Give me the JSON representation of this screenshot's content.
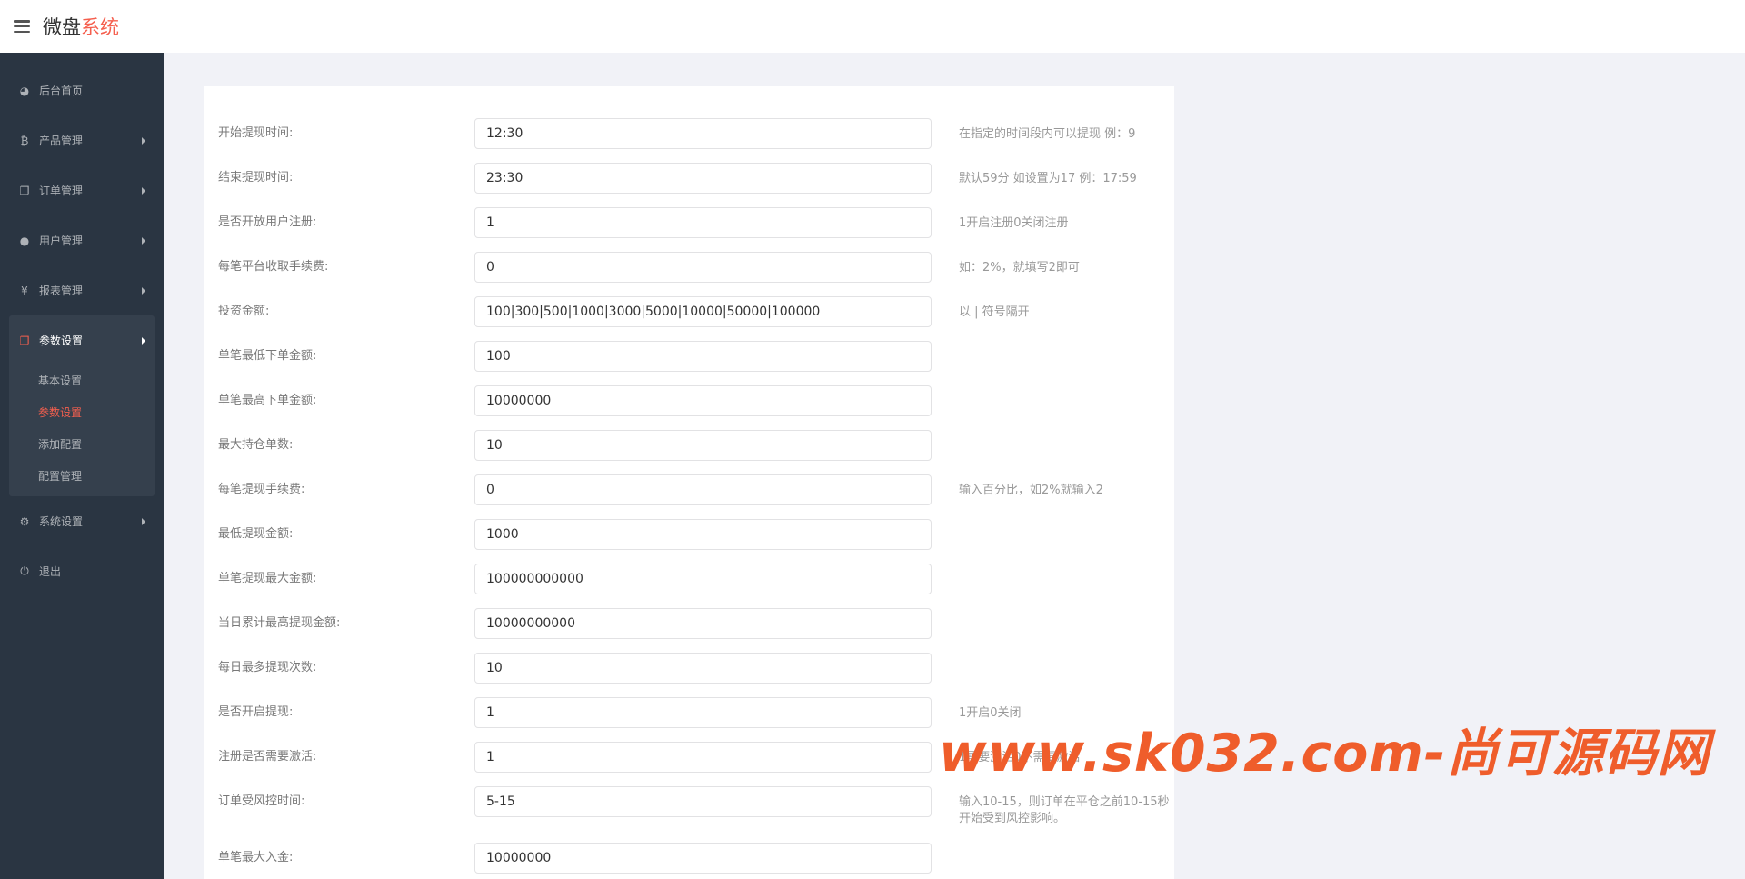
{
  "header": {
    "brand_main": "微盘",
    "brand_accent": "系统"
  },
  "sidebar": {
    "items": [
      {
        "label": "后台首页",
        "icon": "dashboard-icon",
        "glyph": "◕"
      },
      {
        "label": "产品管理",
        "icon": "bitcoin-icon",
        "glyph": "₿"
      },
      {
        "label": "订单管理",
        "icon": "copy-icon",
        "glyph": "❐"
      },
      {
        "label": "用户管理",
        "icon": "user-icon",
        "glyph": "●"
      },
      {
        "label": "报表管理",
        "icon": "yen-icon",
        "glyph": "¥"
      },
      {
        "label": "参数设置",
        "icon": "copy-icon",
        "glyph": "❐"
      },
      {
        "label": "系统设置",
        "icon": "gears-icon",
        "glyph": "⚙"
      },
      {
        "label": "退出",
        "icon": "power-icon",
        "glyph": "⏻"
      }
    ],
    "submenu": [
      "基本设置",
      "参数设置",
      "添加配置",
      "配置管理"
    ]
  },
  "form": {
    "rows": [
      {
        "label": "开始提现时间:",
        "value": "12:30",
        "help": "在指定的时间段内可以提现 例：9"
      },
      {
        "label": "结束提现时间:",
        "value": "23:30",
        "help": "默认59分 如设置为17 例：17:59"
      },
      {
        "label": "是否开放用户注册:",
        "value": "1",
        "help": "1开启注册0关闭注册"
      },
      {
        "label": "每笔平台收取手续费:",
        "value": "0",
        "help": "如：2%，就填写2即可"
      },
      {
        "label": "投资金额:",
        "value": "100|300|500|1000|3000|5000|10000|50000|100000",
        "help": "以 | 符号隔开"
      },
      {
        "label": "单笔最低下单金额:",
        "value": "100",
        "help": ""
      },
      {
        "label": "单笔最高下单金额:",
        "value": "10000000",
        "help": ""
      },
      {
        "label": "最大持仓单数:",
        "value": "10",
        "help": ""
      },
      {
        "label": "每笔提现手续费:",
        "value": "0",
        "help": "输入百分比，如2%就输入2"
      },
      {
        "label": "最低提现金额:",
        "value": "1000",
        "help": ""
      },
      {
        "label": "单笔提现最大金额:",
        "value": "100000000000",
        "help": ""
      },
      {
        "label": "当日累计最高提现金额:",
        "value": "10000000000",
        "help": ""
      },
      {
        "label": "每日最多提现次数:",
        "value": "10",
        "help": ""
      },
      {
        "label": "是否开启提现:",
        "value": "1",
        "help": "1开启0关闭"
      },
      {
        "label": "注册是否需要激活:",
        "value": "1",
        "help": "1需要激活0不需要激活"
      },
      {
        "label": "订单受风控时间:",
        "value": "5-15",
        "help": "输入10-15，则订单在平仓之前10-15秒开始受到风控影响。"
      },
      {
        "label": "单笔最大入金:",
        "value": "10000000",
        "help": ""
      }
    ]
  },
  "watermark": "www.sk032.com-尚可源码网",
  "colors": {
    "accent": "#f55f4e",
    "sidebar_bg": "#2a3542",
    "watermark": "#ef5d2b"
  }
}
